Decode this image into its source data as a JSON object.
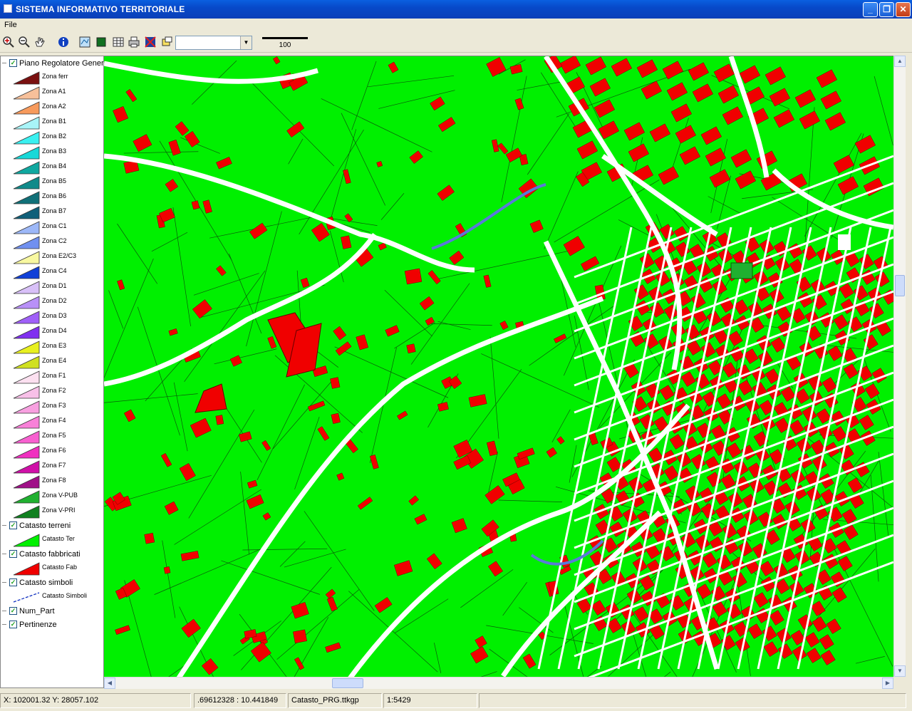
{
  "window": {
    "title": "SISTEMA INFORMATIVO TERRITORIALE"
  },
  "menu": {
    "items": [
      "File"
    ]
  },
  "toolbar": {
    "scale_combo_value": "",
    "scalebar_label": "100"
  },
  "legend": {
    "layers": [
      {
        "name": "Piano Regolatore Generale",
        "checked": true,
        "items": [
          {
            "label": "Zona ferr",
            "color": "#7a1010"
          },
          {
            "label": "Zona A1",
            "color": "#f7c09a"
          },
          {
            "label": "Zona A2",
            "color": "#f79a5c"
          },
          {
            "label": "Zona B1",
            "color": "#a8f4f8"
          },
          {
            "label": "Zona B2",
            "color": "#3af0f0"
          },
          {
            "label": "Zona B3",
            "color": "#18d8d8"
          },
          {
            "label": "Zona B4",
            "color": "#10a8a0"
          },
          {
            "label": "Zona B5",
            "color": "#108a8a"
          },
          {
            "label": "Zona B6",
            "color": "#107078"
          },
          {
            "label": "Zona B7",
            "color": "#10607a"
          },
          {
            "label": "Zona C1",
            "color": "#9db8f8"
          },
          {
            "label": "Zona C2",
            "color": "#7090f0"
          },
          {
            "label": "Zona E2/C3",
            "color": "#f8f8a0"
          },
          {
            "label": "Zona C4",
            "color": "#1040d8"
          },
          {
            "label": "Zona D1",
            "color": "#d8c0f8"
          },
          {
            "label": "Zona D2",
            "color": "#b890f8"
          },
          {
            "label": "Zona D3",
            "color": "#a060f8"
          },
          {
            "label": "Zona D4",
            "color": "#8030f0"
          },
          {
            "label": "Zona E3",
            "color": "#e8f020"
          },
          {
            "label": "Zona E4",
            "color": "#d0e020"
          },
          {
            "label": "Zona F1",
            "color": "#fce0f0"
          },
          {
            "label": "Zona F2",
            "color": "#f8c0e8"
          },
          {
            "label": "Zona F3",
            "color": "#f8a0e0"
          },
          {
            "label": "Zona F4",
            "color": "#f880d8"
          },
          {
            "label": "Zona F5",
            "color": "#f860d0"
          },
          {
            "label": "Zona F6",
            "color": "#f030c0"
          },
          {
            "label": "Zona F7",
            "color": "#d010a8"
          },
          {
            "label": "Zona F8",
            "color": "#a01088"
          },
          {
            "label": "Zona V-PUB",
            "color": "#20b030"
          },
          {
            "label": "Zona V-PRI",
            "color": "#108020"
          }
        ]
      },
      {
        "name": "Catasto terreni",
        "checked": true,
        "items": [
          {
            "label": "Catasto Ter",
            "color": "#00f000"
          }
        ]
      },
      {
        "name": "Catasto fabbricati",
        "checked": true,
        "items": [
          {
            "label": "Catasto Fab",
            "color": "#f00000"
          }
        ]
      },
      {
        "name": "Catasto simboli",
        "checked": true,
        "items": [
          {
            "label": "Catasto Simboli",
            "color": "#1030c0"
          }
        ]
      },
      {
        "name": "Num_Part",
        "checked": true,
        "items": []
      },
      {
        "name": "Pertinenze",
        "checked": true,
        "items": []
      }
    ]
  },
  "map": {
    "colors": {
      "land": "#00f000",
      "buildings": "#f00000",
      "roads": "#ffffff",
      "lines": "#0a5a0a",
      "water": "#5a7ad8"
    }
  },
  "status": {
    "coords": "X: 102001.32 Y: 28057.102",
    "geo": ".69612328 : 10.441849",
    "file": "Catasto_PRG.ttkgp",
    "scale": "1:5429"
  }
}
